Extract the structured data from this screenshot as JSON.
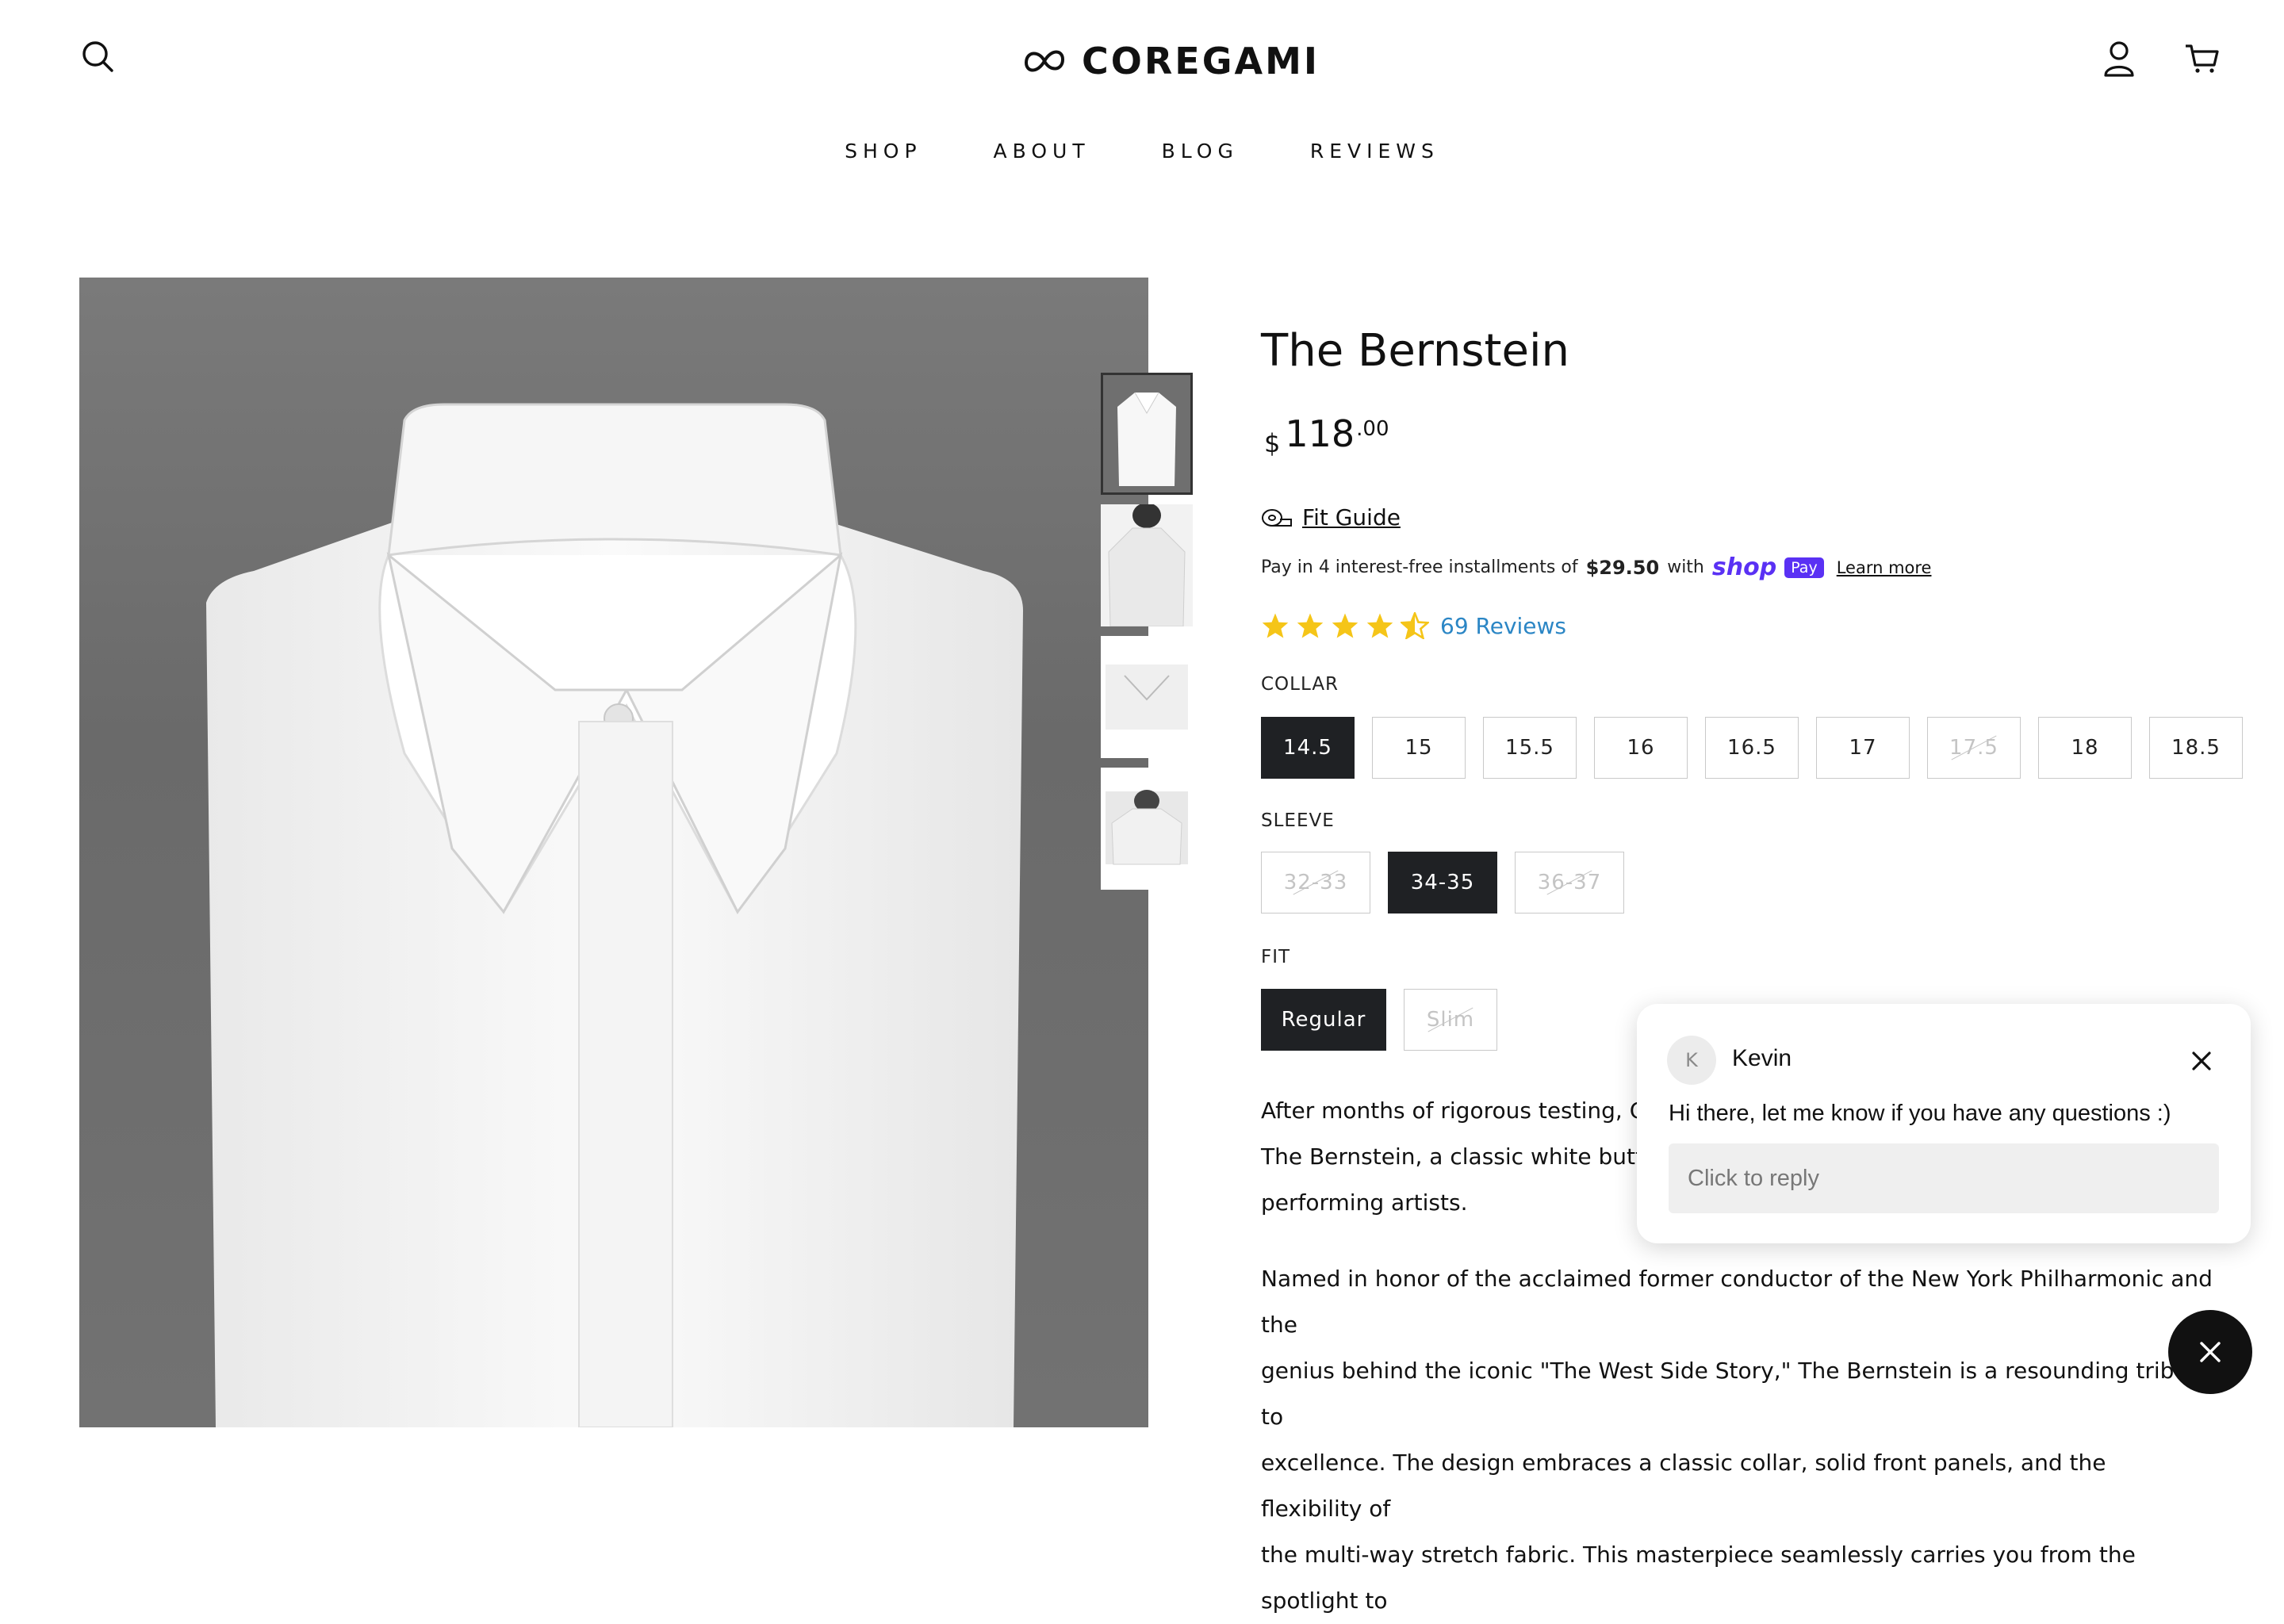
{
  "brand": {
    "name": "COREGAMI",
    "logo_icon": "infinity-knot-icon"
  },
  "header": {
    "search_icon": "search-icon",
    "account_icon": "user-icon",
    "cart_icon": "cart-icon"
  },
  "nav": {
    "items": [
      {
        "label": "SHOP"
      },
      {
        "label": "ABOUT"
      },
      {
        "label": "BLOG"
      },
      {
        "label": "REVIEWS"
      }
    ]
  },
  "product": {
    "title": "The Bernstein",
    "price": {
      "currency": "$",
      "amount": "118",
      "cents": ".00"
    },
    "fit_guide": "Fit Guide",
    "installments": {
      "prefix": "Pay in 4 interest-free installments of",
      "amount": "$29.50",
      "middle": "with",
      "shop_logo": "shop",
      "pay_badge": "Pay",
      "learn_more": "Learn more"
    },
    "rating": {
      "value": 4.5,
      "max": 5,
      "reviews_label": "69 Reviews",
      "star_color": "#f5c518"
    },
    "collar": {
      "label": "COLLAR",
      "options": [
        {
          "value": "14.5",
          "state": "selected"
        },
        {
          "value": "15",
          "state": "available"
        },
        {
          "value": "15.5",
          "state": "available"
        },
        {
          "value": "16",
          "state": "available"
        },
        {
          "value": "16.5",
          "state": "available"
        },
        {
          "value": "17",
          "state": "available"
        },
        {
          "value": "17.5",
          "state": "unavailable"
        },
        {
          "value": "18",
          "state": "available"
        },
        {
          "value": "18.5",
          "state": "available"
        }
      ]
    },
    "sleeve": {
      "label": "SLEEVE",
      "options": [
        {
          "value": "32-33",
          "state": "unavailable"
        },
        {
          "value": "34-35",
          "state": "selected"
        },
        {
          "value": "36-37",
          "state": "unavailable"
        }
      ]
    },
    "fit": {
      "label": "FIT",
      "options": [
        {
          "value": "Regular",
          "state": "selected"
        },
        {
          "value": "Slim",
          "state": "unavailable"
        }
      ]
    },
    "description": [
      "After months of rigorous testing, Cor",
      "The Bernstein, a classic white button",
      "performing artists.",
      "Named in honor of the acclaimed former conductor of the New York Philharmonic and the",
      "genius behind the iconic \"The West Side Story,\" The Bernstein is a resounding tribute to",
      "excellence. The design embraces a classic collar, solid front panels, and the flexibility of",
      "the multi-way stretch fabric. This masterpiece seamlessly carries you from the spotlight to"
    ]
  },
  "gallery": {
    "thumbnails": [
      {
        "active": true
      },
      {
        "active": false
      },
      {
        "active": false
      },
      {
        "active": false
      }
    ]
  },
  "chat": {
    "agent_initial": "K",
    "agent_name": "Kevin",
    "message": "Hi there, let me know if you have any questions :)",
    "reply_placeholder": "Click to reply",
    "close_icon": "close-icon",
    "fab_icon": "close-icon"
  },
  "colors": {
    "selected_option": "#1f2124",
    "link": "#2b86c5",
    "shop_pay": "#5a31f4"
  }
}
